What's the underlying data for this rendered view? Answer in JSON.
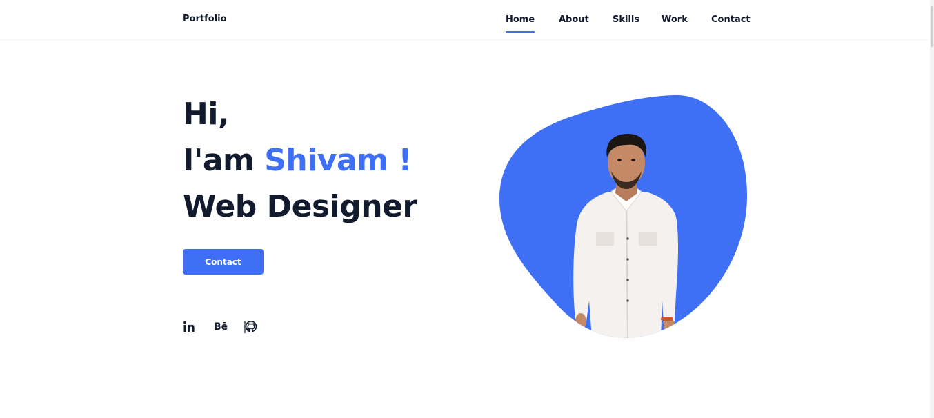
{
  "header": {
    "logo": "Portfolio",
    "nav": [
      {
        "label": "Home",
        "active": true
      },
      {
        "label": "About",
        "active": false
      },
      {
        "label": "Skills",
        "active": false
      },
      {
        "label": "Work",
        "active": false
      },
      {
        "label": "Contact",
        "active": false
      }
    ]
  },
  "hero": {
    "line1": "Hi,",
    "line2_prefix": "I'am ",
    "line2_name": "Shivam !",
    "line3": "Web Designer",
    "button_label": "Contact"
  },
  "social": [
    {
      "name": "linkedin-icon",
      "text": "in"
    },
    {
      "name": "behance-icon",
      "text": "Bē"
    },
    {
      "name": "github-icon",
      "text": ""
    }
  ],
  "colors": {
    "accent": "#3e6ff4",
    "text": "#121a2e"
  }
}
